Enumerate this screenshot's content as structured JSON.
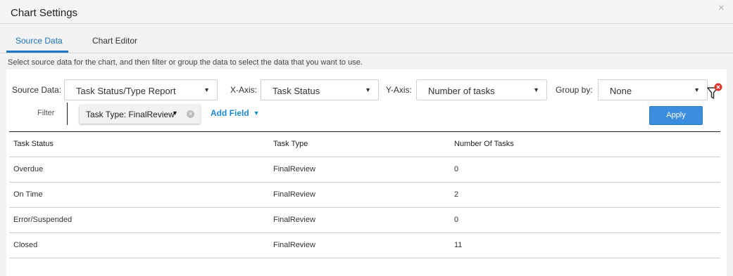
{
  "dialog": {
    "title": "Chart Settings",
    "close_icon": "×"
  },
  "tabs": [
    {
      "label": "Source Data",
      "active": true
    },
    {
      "label": "Chart Editor",
      "active": false
    }
  ],
  "instructions": "Select source data for the chart, and then filter or group the data to select the data that you want to use.",
  "controls": {
    "source_data": {
      "label": "Source Data:",
      "value": "Task Status/Type Report"
    },
    "x_axis": {
      "label": "X-Axis:",
      "value": "Task Status"
    },
    "y_axis": {
      "label": "Y-Axis:",
      "value": "Number of tasks"
    },
    "group_by": {
      "label": "Group by:",
      "value": "None"
    }
  },
  "filter": {
    "label": "Filter",
    "chip": "Task Type: FinalReview",
    "add_field": "Add Field",
    "apply": "Apply"
  },
  "table": {
    "columns": [
      "Task Status",
      "Task Type",
      "Number Of Tasks"
    ],
    "rows": [
      [
        "Overdue",
        "FinalReview",
        "0"
      ],
      [
        "On Time",
        "FinalReview",
        "2"
      ],
      [
        "Error/Suspended",
        "FinalReview",
        "0"
      ],
      [
        "Closed",
        "FinalReview",
        "11"
      ]
    ]
  },
  "colors": {
    "accent": "#1d74c3",
    "apply_button": "#3b8de0",
    "filter_badge": "#e0302a"
  }
}
